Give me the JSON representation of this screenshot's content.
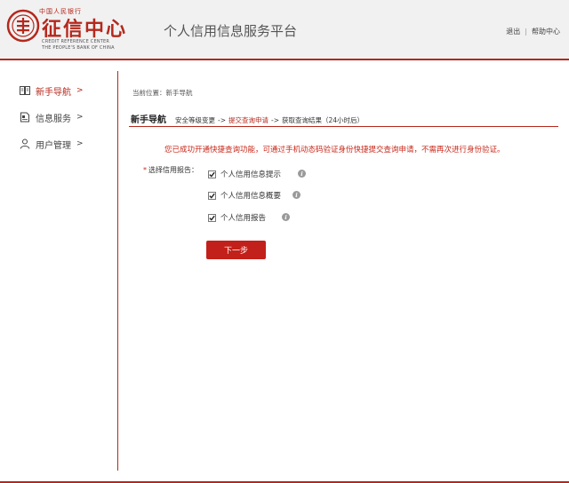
{
  "header": {
    "logo_top": "中国人民银行",
    "logo_main": "征信中心",
    "logo_en_line1": "CREDIT REFERENCE CENTER",
    "logo_en_line2": "THE PEOPLE'S BANK OF CHINA",
    "site_title": "个人信用信息服务平台",
    "logout_label": "退出",
    "separator": "|",
    "help_label": "帮助中心"
  },
  "sidebar": {
    "items": [
      {
        "label": "新手导航",
        "arrow": ">",
        "icon": "book-icon",
        "active": true
      },
      {
        "label": "信息服务",
        "arrow": ">",
        "icon": "document-icon",
        "active": false
      },
      {
        "label": "用户管理",
        "arrow": ">",
        "icon": "user-icon",
        "active": false
      }
    ]
  },
  "main": {
    "breadcrumb": "当前位置：新手导航",
    "steps_title": "新手导航",
    "steps": [
      "安全等级变更",
      "提交查询申请",
      "获取查询结果（24小时后）"
    ],
    "current_step_index": 1,
    "step_arrow": "->",
    "notice": "您已成功开通快捷查询功能，可通过手机动态码验证身份快捷提交查询申请，不需再次进行身份验证。",
    "select_required_mark": "*",
    "select_label": "选择信用报告：",
    "options": [
      {
        "label": "个人信用信息提示",
        "checked": true
      },
      {
        "label": "个人信用信息概要",
        "checked": true
      },
      {
        "label": "个人信用报告",
        "checked": true
      }
    ],
    "info_glyph": "i",
    "next_button": "下一步"
  },
  "colors": {
    "brand_red": "#b5281c",
    "button_red": "#c2201a",
    "notice_red": "#c8281a",
    "header_bg": "#f1f1f1"
  }
}
